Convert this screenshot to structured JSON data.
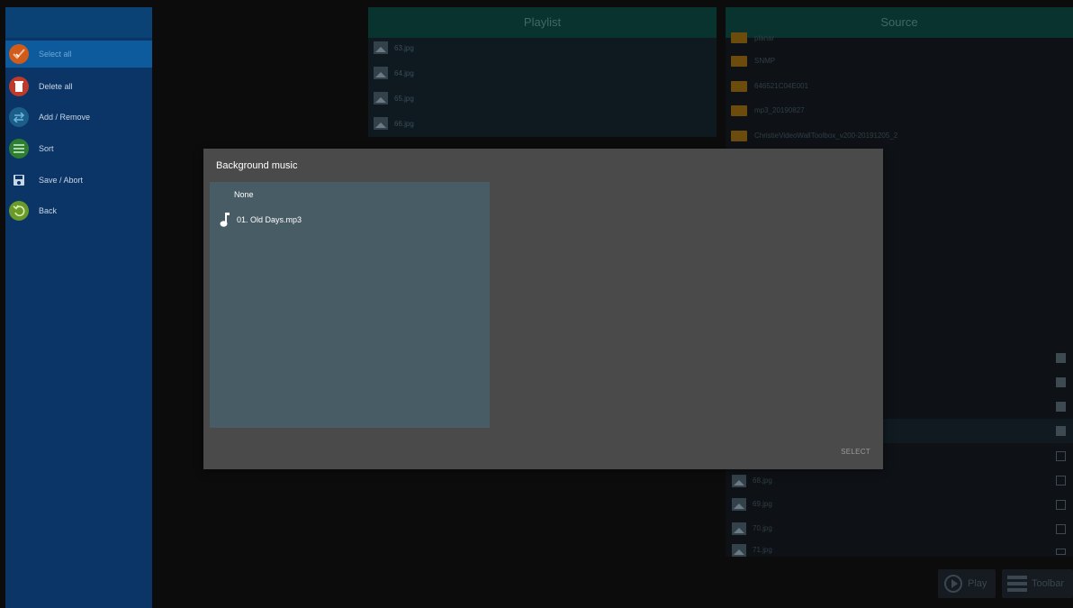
{
  "sidebar": {
    "items": [
      {
        "label": "Select all",
        "icon": "checkmark-icon",
        "color": "#d35b1a"
      },
      {
        "label": "Delete all",
        "icon": "trash-icon",
        "color": "#c0392b"
      },
      {
        "label": "Add / Remove",
        "icon": "swap-arrows-icon",
        "color": "#1b5e8a"
      },
      {
        "label": "Sort",
        "icon": "list-icon",
        "color": "#2e7d32"
      },
      {
        "label": "Save / Abort",
        "icon": "save-icon",
        "color": "#0a3566"
      },
      {
        "label": "Back",
        "icon": "undo-icon",
        "color": "#6a9a2a"
      }
    ]
  },
  "playlist": {
    "title": "Playlist",
    "items": [
      "63.jpg",
      "64.jpg",
      "65.jpg",
      "66.jpg"
    ]
  },
  "source": {
    "title": "Source",
    "folders": [
      "planar",
      "SNMP",
      "646521C04E001",
      "mp3_20190827",
      "ChristieVideoWallToolbox_v200-20191205_2"
    ],
    "files": [
      "68.jpg",
      "69.jpg",
      "70.jpg",
      "71.jpg"
    ],
    "checkbox_states": [
      true,
      true,
      true,
      true,
      false,
      false,
      false,
      false,
      false
    ]
  },
  "bottombar": {
    "play_label": "Play",
    "toolbar_label": "Toolbar"
  },
  "dialog": {
    "title": "Background music",
    "options": [
      {
        "label": "None",
        "icon": ""
      },
      {
        "label": "01. Old Days.mp3",
        "icon": "music-note-icon"
      }
    ],
    "select_label": "SELECT"
  }
}
